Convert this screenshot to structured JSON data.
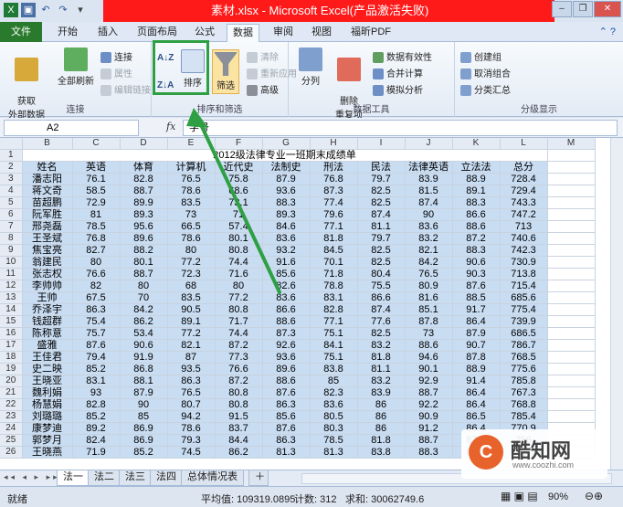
{
  "window": {
    "title": "素材.xlsx - Microsoft Excel(产品激活失败)",
    "controls": [
      "?",
      "–",
      "❐",
      "✕"
    ]
  },
  "ribbon_tabs": [
    "文件",
    "开始",
    "插入",
    "页面布局",
    "公式",
    "数据",
    "审阅",
    "视图",
    "福昕PDF"
  ],
  "active_tab": "数据",
  "ribbon": {
    "get_external": "获取\n外部数据",
    "refresh_all": "全部刷新",
    "connections": "连接",
    "properties": "属性",
    "edit_links": "编辑链接",
    "group_connections": "连接",
    "sort_az": "A↓Z",
    "sort_za": "Z↓A",
    "sort": "排序",
    "filter": "筛选",
    "clear": "清除",
    "reapply": "重新应用",
    "advanced": "高级",
    "group_sort_filter": "排序和筛选",
    "text_to_columns": "分列",
    "remove_duplicates": "删除\n重复项",
    "data_validation": "数据有效性",
    "consolidate": "合并计算",
    "what_if": "模拟分析",
    "group_data_tools": "数据工具",
    "group": "创建组",
    "ungroup": "取消组合",
    "subtotal": "分类汇总",
    "group_outline": "分级显示"
  },
  "formula_bar": {
    "cell_ref": "A2",
    "fx": "fx",
    "content": "学号"
  },
  "sheet": {
    "columns": [
      "B",
      "C",
      "D",
      "E",
      "F",
      "G",
      "H",
      "I",
      "J",
      "K",
      "L",
      "M"
    ],
    "title_row": "2012级法律专业一班期末成绩单",
    "headers": [
      "姓名",
      "英语",
      "体育",
      "计算机",
      "近代史",
      "法制史",
      "刑法",
      "民法",
      "法律英语",
      "立法法",
      "总分"
    ],
    "rows": [
      [
        "潘志阳",
        "76.1",
        "82.8",
        "76.5",
        "75.8",
        "87.9",
        "76.8",
        "79.7",
        "83.9",
        "88.9",
        "728.4"
      ],
      [
        "蒋文奇",
        "58.5",
        "88.7",
        "78.6",
        "68.6",
        "93.6",
        "87.3",
        "82.5",
        "81.5",
        "89.1",
        "729.4"
      ],
      [
        "苗超鹏",
        "72.9",
        "89.9",
        "83.5",
        "73.1",
        "88.3",
        "77.4",
        "82.5",
        "87.4",
        "88.3",
        "743.3"
      ],
      [
        "阮军胜",
        "81",
        "89.3",
        "73",
        "71",
        "89.3",
        "79.6",
        "87.4",
        "90",
        "86.6",
        "747.2"
      ],
      [
        "邢尧磊",
        "78.5",
        "95.6",
        "66.5",
        "57.4",
        "84.6",
        "77.1",
        "81.1",
        "83.6",
        "88.6",
        "713"
      ],
      [
        "王圣斌",
        "76.8",
        "89.6",
        "78.6",
        "80.1",
        "83.6",
        "81.8",
        "79.7",
        "83.2",
        "87.2",
        "740.6"
      ],
      [
        "焦宝亮",
        "82.7",
        "88.2",
        "80",
        "80.8",
        "93.2",
        "84.5",
        "82.5",
        "82.1",
        "88.3",
        "742.3"
      ],
      [
        "翁建民",
        "80",
        "80.1",
        "77.2",
        "74.4",
        "91.6",
        "70.1",
        "82.5",
        "84.2",
        "90.6",
        "730.9"
      ],
      [
        "张志权",
        "76.6",
        "88.7",
        "72.3",
        "71.6",
        "85.6",
        "71.8",
        "80.4",
        "76.5",
        "90.3",
        "713.8"
      ],
      [
        "李帅帅",
        "82",
        "80",
        "68",
        "80",
        "82.6",
        "78.8",
        "75.5",
        "80.9",
        "87.6",
        "715.4"
      ],
      [
        "王帅",
        "67.5",
        "70",
        "83.5",
        "77.2",
        "83.6",
        "83.1",
        "86.6",
        "81.6",
        "88.5",
        "685.6"
      ],
      [
        "乔泽宇",
        "86.3",
        "84.2",
        "90.5",
        "80.8",
        "86.6",
        "82.8",
        "87.4",
        "85.1",
        "91.7",
        "775.4"
      ],
      [
        "钱超群",
        "75.4",
        "86.2",
        "89.1",
        "71.7",
        "88.6",
        "77.1",
        "77.6",
        "87.8",
        "86.4",
        "739.9"
      ],
      [
        "陈称意",
        "75.7",
        "53.4",
        "77.2",
        "74.4",
        "87.3",
        "75.1",
        "82.5",
        "73",
        "87.9",
        "686.5"
      ],
      [
        "盛雅",
        "87.6",
        "90.6",
        "82.1",
        "87.2",
        "92.6",
        "84.1",
        "83.2",
        "88.6",
        "90.7",
        "786.7"
      ],
      [
        "王佳君",
        "79.4",
        "91.9",
        "87",
        "77.3",
        "93.6",
        "75.1",
        "81.8",
        "94.6",
        "87.8",
        "768.5"
      ],
      [
        "史二映",
        "85.2",
        "86.8",
        "93.5",
        "76.6",
        "89.6",
        "83.8",
        "81.1",
        "90.1",
        "88.9",
        "775.6"
      ],
      [
        "王晓亚",
        "83.1",
        "88.1",
        "86.3",
        "87.2",
        "88.6",
        "85",
        "83.2",
        "92.9",
        "91.4",
        "785.8"
      ],
      [
        "魏利娟",
        "93",
        "87.9",
        "76.5",
        "80.8",
        "87.6",
        "82.3",
        "83.9",
        "88.7",
        "86.4",
        "767.3"
      ],
      [
        "杨慧娟",
        "82.8",
        "90",
        "80.7",
        "80.8",
        "86.3",
        "83.6",
        "86",
        "92.2",
        "86.4",
        "768.8"
      ],
      [
        "刘璐璐",
        "85.2",
        "85",
        "94.2",
        "91.5",
        "85.6",
        "80.5",
        "86",
        "90.9",
        "86.5",
        "785.4"
      ],
      [
        "康梦迪",
        "89.2",
        "86.9",
        "78.6",
        "83.7",
        "87.6",
        "80.3",
        "86",
        "91.2",
        "86.4",
        "770.9"
      ],
      [
        "郭梦月",
        "82.4",
        "86.9",
        "79.3",
        "84.4",
        "86.3",
        "78.5",
        "81.8",
        "88.7",
        "87.7",
        "756"
      ],
      [
        "王晓燕",
        "71.9",
        "85.2",
        "74.5",
        "86.2",
        "81.3",
        "81.3",
        "83.8",
        "88.3",
        "86.4",
        "758.9"
      ]
    ]
  },
  "sheet_tabs": [
    "法一",
    "法二",
    "法三",
    "法四",
    "总体情况表"
  ],
  "active_sheet": "法一",
  "status": {
    "mode": "就绪",
    "average": "平均值: 109319.0895",
    "count": "计数: 312",
    "sum": "求和: 30062749.6",
    "zoom": "90%"
  },
  "watermark": {
    "logo": "C",
    "text": "酷知网",
    "url": "www.coozhi.com"
  },
  "colors": {
    "title_bar_red": "#ff1a1a",
    "file_tab_green": "#2a7a2e",
    "selection_blue": "#c8dcf2",
    "annotation_green": "#2ea043"
  }
}
